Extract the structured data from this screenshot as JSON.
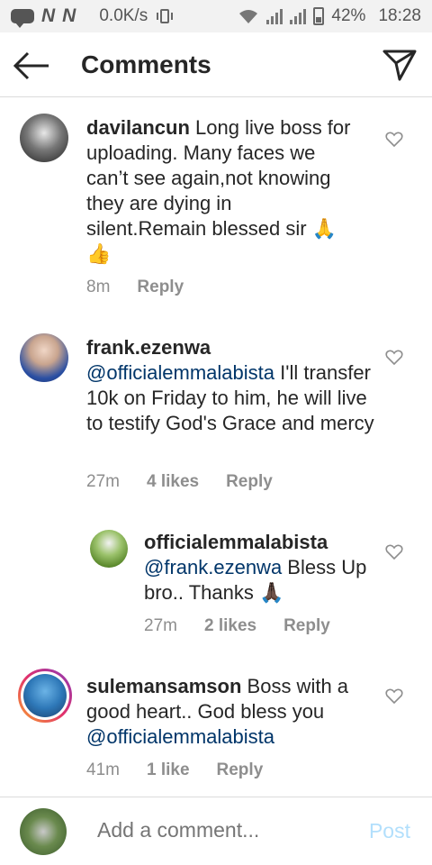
{
  "status_bar": {
    "net_speed": "0.0K/s",
    "battery": "42%",
    "time": "18:28",
    "n_label": "N"
  },
  "header": {
    "title": "Comments"
  },
  "comments": [
    {
      "username": "davilancun",
      "text": "Long live boss for uploading. Many faces we can’t see again,not knowing they are dying in silent.Remain blessed sir 🙏 👍",
      "time": "8m",
      "likes": "",
      "reply": "Reply"
    },
    {
      "username": "frank.ezenwa",
      "mention": "@officialemmalabista",
      "text": " I'll transfer 10k on Friday to him, he will live to testify God's Grace and mercy",
      "time": "27m",
      "likes": "4 likes",
      "reply": "Reply"
    },
    {
      "username": "officialemmalabista",
      "mention": "@frank.ezenwa",
      "text": " Bless Up bro.. Thanks 🙏🏿",
      "time": "27m",
      "likes": "2 likes",
      "reply": "Reply"
    },
    {
      "username": "sulemansamson",
      "text": "Boss with a good heart.. God bless you ",
      "mention": "@officialemmalabista",
      "time": "41m",
      "likes": "1 like",
      "reply": "Reply"
    }
  ],
  "add_comment": {
    "placeholder": "Add a comment...",
    "post_label": "Post"
  },
  "colors": {
    "mention": "#003569",
    "post_disabled": "#b2dffc",
    "meta_gray": "#8e8e8e"
  }
}
